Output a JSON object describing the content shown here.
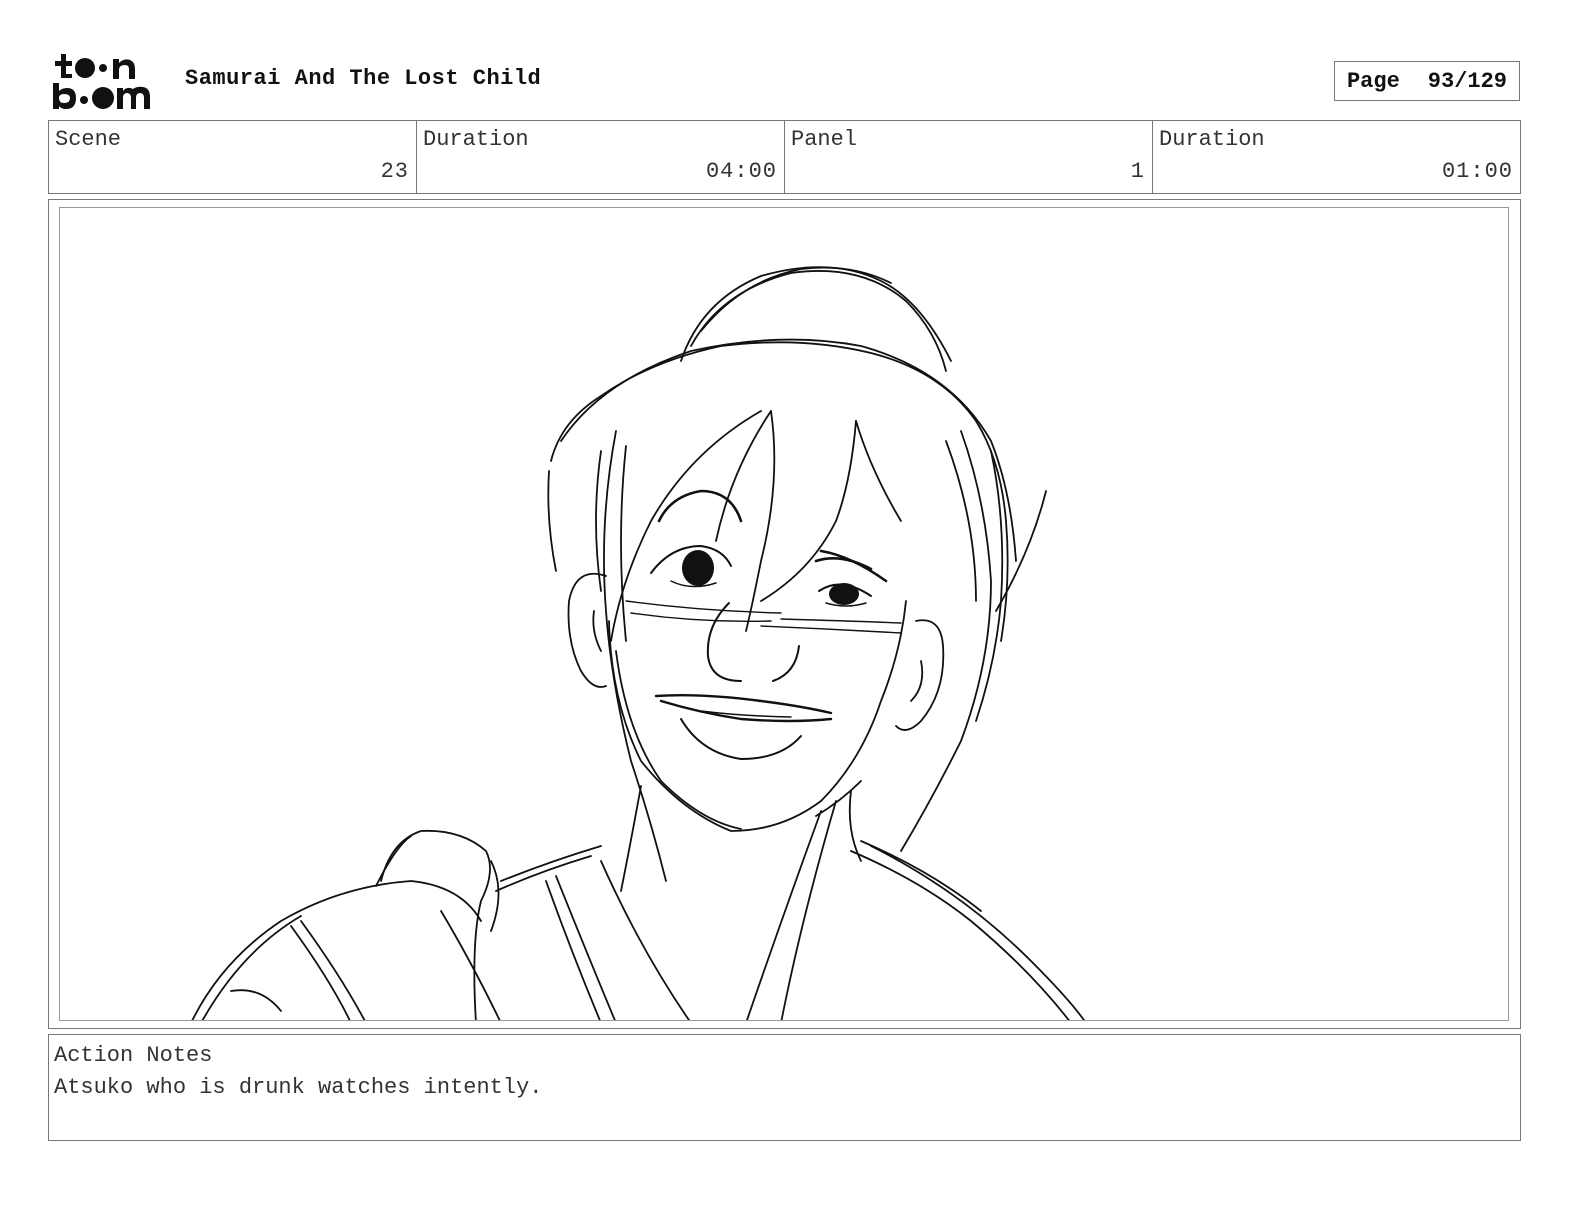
{
  "header": {
    "logo_text": "toon boom",
    "project_title": "Samurai And The Lost Child",
    "page_label": "Page",
    "page_number": "93/129"
  },
  "info": {
    "scene_label": "Scene",
    "scene_value": "23",
    "scene_duration_label": "Duration",
    "scene_duration_value": "04:00",
    "panel_label": "Panel",
    "panel_value": "1",
    "panel_duration_label": "Duration",
    "panel_duration_value": "01:00"
  },
  "notes": {
    "label": "Action Notes",
    "text": "Atsuko who is drunk watches intently."
  },
  "colors": {
    "stroke": "#111111",
    "border": "#777777"
  }
}
